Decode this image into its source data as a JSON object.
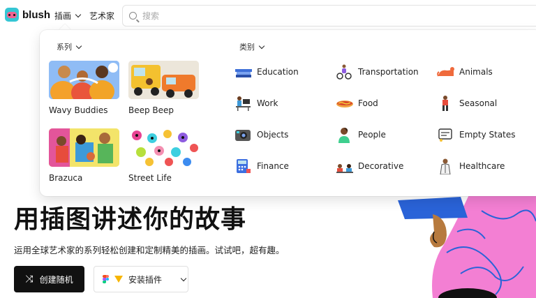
{
  "brand": {
    "name": "blush"
  },
  "nav": {
    "illustrations_label": "插画",
    "artists_label": "艺术家"
  },
  "search": {
    "placeholder": "搜索"
  },
  "dropdown": {
    "series_heading": "系列",
    "category_heading": "类别",
    "series": [
      {
        "name": "Wavy Buddies"
      },
      {
        "name": "Beep Beep"
      },
      {
        "name": "Brazuca"
      },
      {
        "name": "Street Life"
      }
    ],
    "categories": [
      {
        "label": "Education",
        "icon": "books-icon"
      },
      {
        "label": "Transportation",
        "icon": "bicycle-rider-icon"
      },
      {
        "label": "Animals",
        "icon": "animal-icon"
      },
      {
        "label": "Work",
        "icon": "desk-worker-icon"
      },
      {
        "label": "Food",
        "icon": "hotdog-icon"
      },
      {
        "label": "Seasonal",
        "icon": "seasonal-person-icon"
      },
      {
        "label": "Objects",
        "icon": "camera-icon"
      },
      {
        "label": "People",
        "icon": "person-icon"
      },
      {
        "label": "Empty States",
        "icon": "empty-state-icon"
      },
      {
        "label": "Finance",
        "icon": "calculator-icon"
      },
      {
        "label": "Decorative",
        "icon": "decorative-icon"
      },
      {
        "label": "Healthcare",
        "icon": "doctor-icon"
      }
    ]
  },
  "hero": {
    "title": "用插图讲述你的故事",
    "subtitle": "运用全球艺术家的系列轻松创建和定制精美的插画。试试吧，超有趣。",
    "random_button": "创建随机",
    "plugin_button": "安装插件"
  },
  "colors": {
    "accent_dark": "#111111",
    "hero_pink": "#f37fd3",
    "hero_blue": "#2a63d8"
  }
}
